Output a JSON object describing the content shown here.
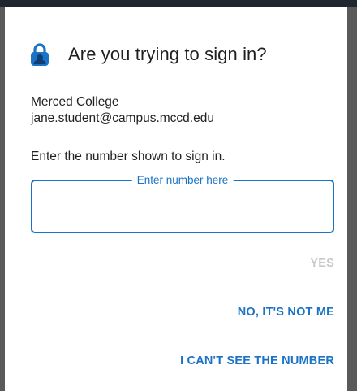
{
  "dialog": {
    "title": "Are you trying to sign in?",
    "icon": "lock-icon",
    "organization": "Merced College",
    "account": "jane.student@campus.mccd.edu",
    "instruction": "Enter the number shown to sign in.",
    "number_input": {
      "label": "Enter number here",
      "value": "",
      "placeholder": "Enter number here"
    },
    "buttons": {
      "yes": "YES",
      "no": "NO, IT'S NOT ME",
      "cant_see": "I CAN'T SEE THE NUMBER"
    }
  },
  "colors": {
    "accent": "#1a73c6",
    "disabled": "#c9c9c9",
    "text": "#222222"
  }
}
